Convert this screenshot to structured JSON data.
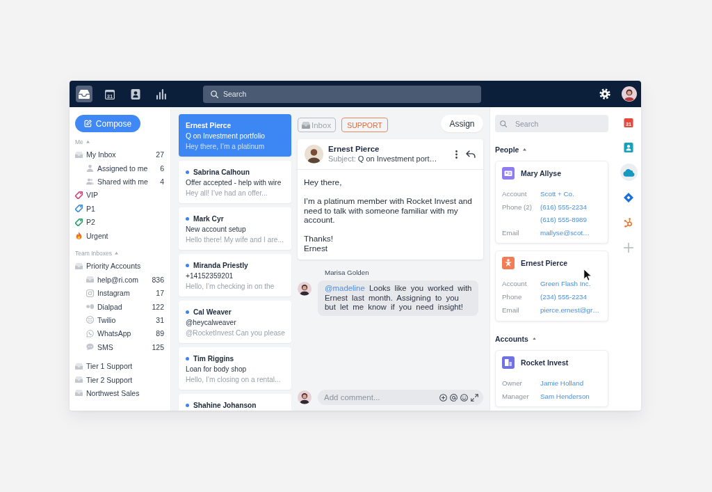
{
  "top_bar": {
    "nav": [
      {
        "kind": "inbox",
        "selected": true
      },
      {
        "kind": "calendar",
        "day": "31",
        "selected": false
      },
      {
        "kind": "contacts",
        "selected": false
      },
      {
        "kind": "reports",
        "selected": false
      }
    ],
    "search": {
      "placeholder": "Search"
    }
  },
  "sidebar": {
    "compose": "Compose",
    "sections": [
      {
        "title": "Me",
        "expanded": true,
        "items": [
          {
            "kind": "inbox",
            "label": "My Inbox",
            "count": "27",
            "children": [
              {
                "kind": "assigned",
                "label": "Assigned to me",
                "count": "6"
              },
              {
                "kind": "shared",
                "label": "Shared with me",
                "count": "4"
              }
            ]
          },
          {
            "kind": "tag",
            "label": "VIP",
            "color": "#d9467a"
          },
          {
            "kind": "tag",
            "label": "P1",
            "color": "#3b8fdb"
          },
          {
            "kind": "tag",
            "label": "P2",
            "color": "#2fa36b"
          },
          {
            "kind": "fire",
            "label": "Urgent"
          }
        ]
      },
      {
        "title": "Team Inboxes",
        "expanded": true,
        "items": [
          {
            "kind": "inbox",
            "label": "Priority Accounts",
            "children": [
              {
                "kind": "inbox",
                "label": "help@ri.com",
                "count": "836"
              },
              {
                "kind": "instagram",
                "label": "Instagram",
                "count": "17"
              },
              {
                "kind": "dialpad",
                "label": "Dialpad",
                "count": "122"
              },
              {
                "kind": "twilio",
                "label": "Twilio",
                "count": "31"
              },
              {
                "kind": "whatsapp",
                "label": "WhatsApp",
                "count": "89"
              },
              {
                "kind": "sms",
                "label": "SMS",
                "count": "125"
              }
            ]
          }
        ]
      },
      {
        "items": [
          {
            "kind": "inbox",
            "label": "Tier 1 Support"
          },
          {
            "kind": "inbox",
            "label": "Tier 2 Support"
          },
          {
            "kind": "inbox",
            "label": "Northwest Sales"
          }
        ]
      }
    ]
  },
  "conversations": [
    {
      "name": "Ernest Pierce",
      "subject": "Q on Investment portfolio",
      "preview": "Hey there, I’m a platinum",
      "unread": false,
      "selected": true
    },
    {
      "name": "Sabrina Calhoun",
      "subject": "Offer accepted - help with wire",
      "preview": "Hey all! I’ve had an offer...",
      "unread": true,
      "selected": false
    },
    {
      "name": "Mark Cyr",
      "subject": "New account setup",
      "preview": "Hello there! My wife and I are...",
      "unread": true,
      "selected": false
    },
    {
      "name": "Miranda Priestly",
      "subject": "+14152359201",
      "preview": "Hello, I’m checking in on the",
      "unread": true,
      "selected": false
    },
    {
      "name": "Cal Weaver",
      "subject": "@heycalweaver",
      "preview": "@RocketInvest Can you please",
      "unread": true,
      "selected": false
    },
    {
      "name": "Tim Riggins",
      "subject": "Loan for body shop",
      "preview": "Hello, I’m closing on a rental...",
      "unread": true,
      "selected": false
    },
    {
      "name": "Shahine Johanson",
      "unread": true,
      "selected": false
    }
  ],
  "conversation": {
    "tags": [
      {
        "kind": "inbox",
        "label": "Inbox"
      },
      {
        "kind": "tag",
        "label": "SUPPORT"
      }
    ],
    "assign": "Assign",
    "message": {
      "sender": "Ernest Pierce",
      "subject_label": "Subject:",
      "subject": "Q on Investment port…",
      "paragraphs": [
        [
          "Hey there,"
        ],
        [
          "I’m a platinum member with Rocket Invest and need to talk with someone familiar with my account."
        ],
        [
          "Thanks!",
          "Ernest"
        ]
      ]
    },
    "comments": [
      {
        "author": "Marisa Golden",
        "mention": "@madeline",
        "text": "Looks like you worked with Ernest last month. Assigning to you but let me know if you need insight!"
      }
    ],
    "composer": {
      "placeholder": "Add comment..."
    }
  },
  "details": {
    "search": {
      "placeholder": "Search"
    },
    "sections": [
      {
        "title": "People",
        "expanded": true,
        "cards": [
          {
            "kind": "contact",
            "name": "Mary Allyse",
            "fields": [
              {
                "label": "Account",
                "values": [
                  "Scott + Co."
                ]
              },
              {
                "label": "Phone (2)",
                "values": [
                  "(616) 555-2234",
                  "(616) 555-8989"
                ]
              },
              {
                "label": "Email",
                "values": [
                  "mallyse@scot…"
                ]
              }
            ]
          },
          {
            "kind": "person",
            "name": "Ernest Pierce",
            "fields": [
              {
                "label": "Account",
                "values": [
                  "Green Flash Inc."
                ]
              },
              {
                "label": "Phone",
                "values": [
                  "(234) 555-2234"
                ]
              },
              {
                "label": "Email",
                "values": [
                  "pierce.ernest@gr…"
                ]
              }
            ]
          }
        ]
      },
      {
        "title": "Accounts",
        "expanded": true,
        "cards": [
          {
            "kind": "company",
            "name": "Rocket Invest",
            "fields": [
              {
                "label": "Owner",
                "values": [
                  "Jamie Holland"
                ]
              },
              {
                "label": "Manager",
                "values": [
                  "Sam Henderson"
                ]
              }
            ]
          }
        ]
      }
    ]
  },
  "integrations": [
    {
      "kind": "calendar",
      "day": "31",
      "selected": false
    },
    {
      "kind": "contacts",
      "selected": false
    },
    {
      "kind": "cloud",
      "selected": true
    },
    {
      "kind": "diamond",
      "selected": false
    },
    {
      "kind": "sprocket",
      "selected": false
    },
    {
      "kind": "add",
      "selected": false
    }
  ]
}
